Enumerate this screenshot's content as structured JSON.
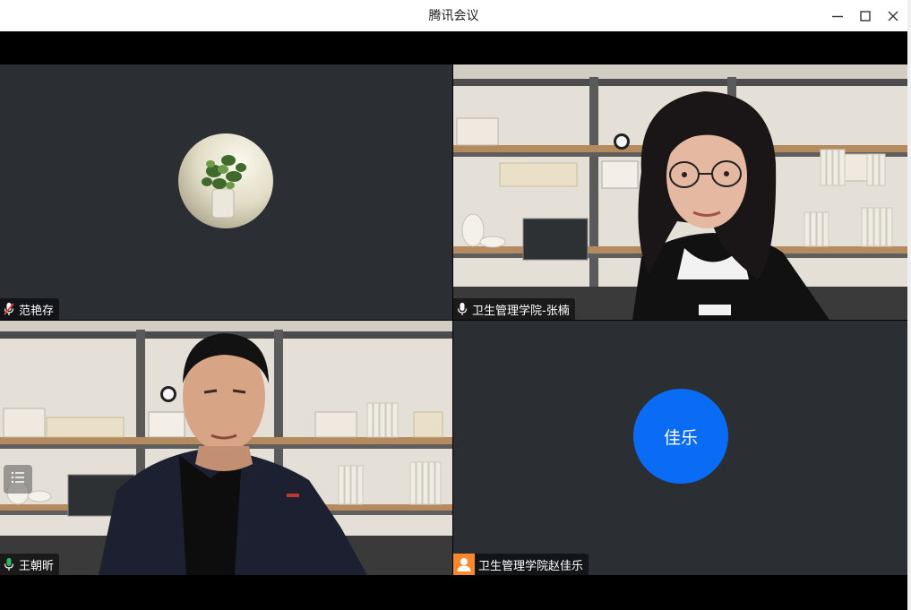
{
  "window": {
    "title": "腾讯会议",
    "controls": [
      "minimize",
      "maximize",
      "close"
    ]
  },
  "participants": [
    {
      "name": "范艳存",
      "mic": "muted",
      "video": false,
      "avatar": "plant-photo"
    },
    {
      "name": "卫生管理学院-张楠",
      "mic": "on",
      "video": true
    },
    {
      "name": "王朝昕",
      "mic": "speaking",
      "video": true,
      "active_speaker": true
    },
    {
      "name": "卫生管理学院赵佳乐",
      "mic": "none",
      "video": false,
      "avatar_text": "佳乐",
      "avatar_color": "#0a6cf5",
      "badge": "user-icon"
    }
  ],
  "colors": {
    "tile_bg": "#2b2e33",
    "speaking_green": "#2fb863",
    "muted_red": "#e5443c",
    "badge_orange": "#f7882d"
  }
}
